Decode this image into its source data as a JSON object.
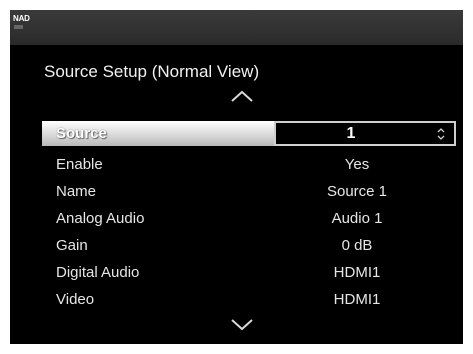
{
  "header": {
    "brand": "NAD"
  },
  "page": {
    "title": "Source Setup (Normal View)"
  },
  "menu": {
    "selected": {
      "label": "Source",
      "value": "1"
    },
    "rows": [
      {
        "label": "Enable",
        "value": "Yes"
      },
      {
        "label": "Name",
        "value": "Source 1"
      },
      {
        "label": "Analog Audio",
        "value": "Audio 1"
      },
      {
        "label": "Gain",
        "value": "0 dB"
      },
      {
        "label": "Digital Audio",
        "value": "HDMI1"
      },
      {
        "label": "Video",
        "value": "HDMI1"
      }
    ]
  },
  "icons": {
    "scroll_up": "chevron-up-icon",
    "scroll_down": "chevron-down-icon",
    "spinner": "up-down-spinner-icon"
  },
  "colors": {
    "background": "#000000",
    "text": "#e6e6e6",
    "highlight": "#d9d9d9",
    "topbar": "#2f2f2f"
  }
}
